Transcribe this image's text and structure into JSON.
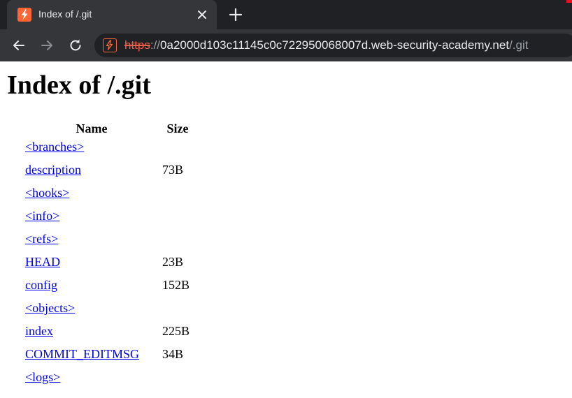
{
  "browser": {
    "tab_title": "Index of /.git",
    "url": {
      "scheme": "https",
      "separator": "://",
      "host": "0a2000d103c11145c0c722950068007d.web-security-academy.net",
      "path": "/.git"
    }
  },
  "page": {
    "title": "Index of /.git",
    "table": {
      "headers": {
        "name": "Name",
        "size": "Size"
      },
      "rows": [
        {
          "name": "<branches>",
          "size": ""
        },
        {
          "name": "description",
          "size": "73B"
        },
        {
          "name": "<hooks>",
          "size": ""
        },
        {
          "name": "<info>",
          "size": ""
        },
        {
          "name": "<refs>",
          "size": ""
        },
        {
          "name": "HEAD",
          "size": "23B"
        },
        {
          "name": "config",
          "size": "152B"
        },
        {
          "name": "<objects>",
          "size": ""
        },
        {
          "name": "index",
          "size": "225B"
        },
        {
          "name": "COMMIT_EDITMSG",
          "size": "34B"
        },
        {
          "name": "<logs>",
          "size": ""
        }
      ]
    }
  },
  "icons": {
    "favicon": "web-security-academy-icon",
    "close": "close-icon",
    "new_tab": "plus-icon",
    "back": "arrow-left-icon",
    "forward": "arrow-right-icon",
    "reload": "reload-icon",
    "site_info": "site-info-icon"
  },
  "colors": {
    "brand": "#ff6633",
    "link": "#0000ee",
    "chrome_dark": "#202124",
    "chrome_tab": "#35363a"
  }
}
